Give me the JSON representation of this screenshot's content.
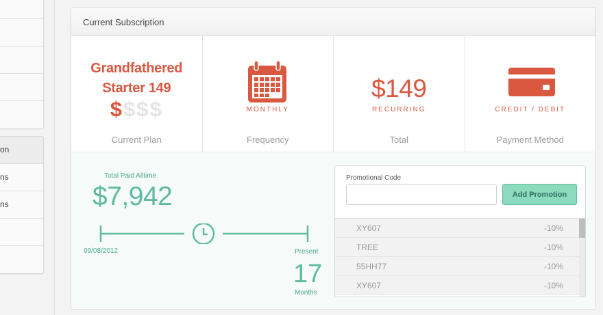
{
  "sidebar": {
    "group_top_rows": [
      "",
      "",
      "",
      "",
      ""
    ],
    "group_bottom_rows": [
      "on",
      "ns",
      "ns",
      "",
      ""
    ]
  },
  "card": {
    "title": "Current Subscription",
    "plan": {
      "name_line1": "Grandfathered",
      "name_line2": "Starter 149",
      "dollar_glyph": "$",
      "dollar_level": 1,
      "dollar_max": 4,
      "label": "Current Plan"
    },
    "frequency": {
      "icon": "calendar-icon",
      "value": "MONTHLY",
      "label": "Frequency"
    },
    "total": {
      "amount": "$149",
      "value": "RECURRING",
      "label": "Total"
    },
    "payment": {
      "icon": "credit-card-icon",
      "value": "CREDIT / DEBIT",
      "label": "Payment Method"
    }
  },
  "history": {
    "total_label": "Total Paid Alltime",
    "total_amount": "$7,942",
    "start_date": "09/08/2012",
    "end_label": "Present",
    "months": "17",
    "months_label": "Months",
    "clock_icon": "clock-icon"
  },
  "promo": {
    "label": "Promotional Code",
    "input_value": "",
    "input_placeholder": "",
    "button_label": "Add Promotion",
    "codes": [
      {
        "code": "XY607",
        "discount": "-10%"
      },
      {
        "code": "TREE",
        "discount": "-10%"
      },
      {
        "code": "55HH77",
        "discount": "-10%"
      },
      {
        "code": "XY607",
        "discount": "-10%"
      }
    ]
  },
  "colors": {
    "accent_red": "#d9583f",
    "accent_teal": "#5fbba0",
    "button_teal": "#8cdbbf"
  }
}
